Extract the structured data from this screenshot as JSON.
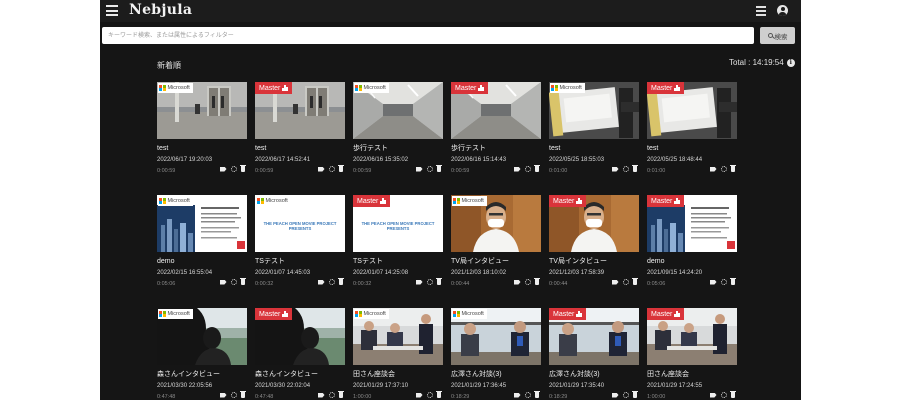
{
  "header": {
    "app_name": "Nebjula"
  },
  "search": {
    "placeholder": "キーワード検索、または属性によるフィルター",
    "button_label": "検索"
  },
  "listing": {
    "sort_label": "新着順",
    "total_label": "Total : 14:19:54",
    "info_glyph": "i"
  },
  "cards": [
    {
      "title": "test",
      "date": "2022/06/17 19:20:03",
      "duration": "0:00:59",
      "badge": "microsoft",
      "thumb": "hallway-door",
      "microsoft_label": "Microsoft",
      "master_label": ""
    },
    {
      "title": "test",
      "date": "2022/06/17 14:52:41",
      "duration": "0:00:59",
      "badge": "master",
      "thumb": "hallway-door",
      "microsoft_label": "",
      "master_label": "Master"
    },
    {
      "title": "歩行テスト",
      "date": "2022/06/16 15:35:02",
      "duration": "0:00:59",
      "badge": "microsoft",
      "thumb": "corridor",
      "microsoft_label": "Microsoft",
      "master_label": ""
    },
    {
      "title": "歩行テスト",
      "date": "2022/06/16 15:14:43",
      "duration": "0:00:59",
      "badge": "master",
      "thumb": "corridor",
      "microsoft_label": "",
      "master_label": "Master"
    },
    {
      "title": "test",
      "date": "2022/05/25 18:55:03",
      "duration": "0:01:00",
      "badge": "microsoft",
      "thumb": "device",
      "microsoft_label": "Microsoft",
      "master_label": ""
    },
    {
      "title": "test",
      "date": "2022/05/25 18:48:44",
      "duration": "0:01:00",
      "badge": "master",
      "thumb": "device",
      "microsoft_label": "",
      "master_label": "Master"
    },
    {
      "title": "demo",
      "date": "2022/02/15 16:55:04",
      "duration": "0:05:06",
      "badge": "microsoft",
      "thumb": "slide-city",
      "microsoft_label": "Microsoft",
      "master_label": ""
    },
    {
      "title": "TSテスト",
      "date": "2022/01/07 14:45:03",
      "duration": "0:00:32",
      "badge": "microsoft",
      "thumb": "peach",
      "microsoft_label": "Microsoft",
      "master_label": ""
    },
    {
      "title": "TSテスト",
      "date": "2022/01/07 14:25:08",
      "duration": "0:00:32",
      "badge": "master",
      "thumb": "peach",
      "microsoft_label": "",
      "master_label": "Master"
    },
    {
      "title": "TV局インタビュー",
      "date": "2021/12/03 18:10:02",
      "duration": "0:00:44",
      "badge": "microsoft",
      "thumb": "doctor",
      "microsoft_label": "Microsoft",
      "master_label": ""
    },
    {
      "title": "TV局インタビュー",
      "date": "2021/12/03 17:58:39",
      "duration": "0:00:44",
      "badge": "master",
      "thumb": "doctor",
      "microsoft_label": "",
      "master_label": "Master"
    },
    {
      "title": "demo",
      "date": "2021/09/15 14:24:20",
      "duration": "0:05:06",
      "badge": "master",
      "thumb": "slide-city",
      "microsoft_label": "",
      "master_label": "Master"
    },
    {
      "title": "森さんインタビュー",
      "date": "2021/03/30 22:05:56",
      "duration": "0:47:48",
      "badge": "microsoft",
      "thumb": "silhouette",
      "microsoft_label": "Microsoft",
      "master_label": ""
    },
    {
      "title": "森さんインタビュー",
      "date": "2021/03/30 22:02:04",
      "duration": "0:47:48",
      "badge": "master",
      "thumb": "silhouette",
      "microsoft_label": "",
      "master_label": "Master"
    },
    {
      "title": "田さん座談会",
      "date": "2021/01/29 17:37:10",
      "duration": "1:00:00",
      "badge": "microsoft",
      "thumb": "meeting",
      "microsoft_label": "Microsoft",
      "master_label": ""
    },
    {
      "title": "広澤さん対談(3)",
      "date": "2021/01/29 17:36:45",
      "duration": "0:18:29",
      "badge": "microsoft",
      "thumb": "dialogue",
      "microsoft_label": "Microsoft",
      "master_label": ""
    },
    {
      "title": "広澤さん対談(3)",
      "date": "2021/01/29 17:35:40",
      "duration": "0:18:29",
      "badge": "master",
      "thumb": "dialogue",
      "microsoft_label": "",
      "master_label": "Master"
    },
    {
      "title": "田さん座談会",
      "date": "2021/01/29 17:24:55",
      "duration": "1:00:00",
      "badge": "master",
      "thumb": "meeting",
      "microsoft_label": "",
      "master_label": "Master"
    }
  ],
  "peach_text": "THE PEACH OPEN MOVIE PROJECT PRESENTS",
  "colors": {
    "master_badge": "#d9343a",
    "background": "#151515",
    "topbar": "#1c1c1c",
    "ms_red": "#f25022",
    "ms_green": "#7fba00",
    "ms_blue": "#00a4ef",
    "ms_yellow": "#ffb900"
  },
  "icons": [
    "menu-icon",
    "list-view-icon",
    "account-icon",
    "search-icon",
    "info-icon",
    "tag-icon",
    "gear-icon",
    "trash-icon",
    "microsoft-logo-icon",
    "master-bars-icon"
  ]
}
